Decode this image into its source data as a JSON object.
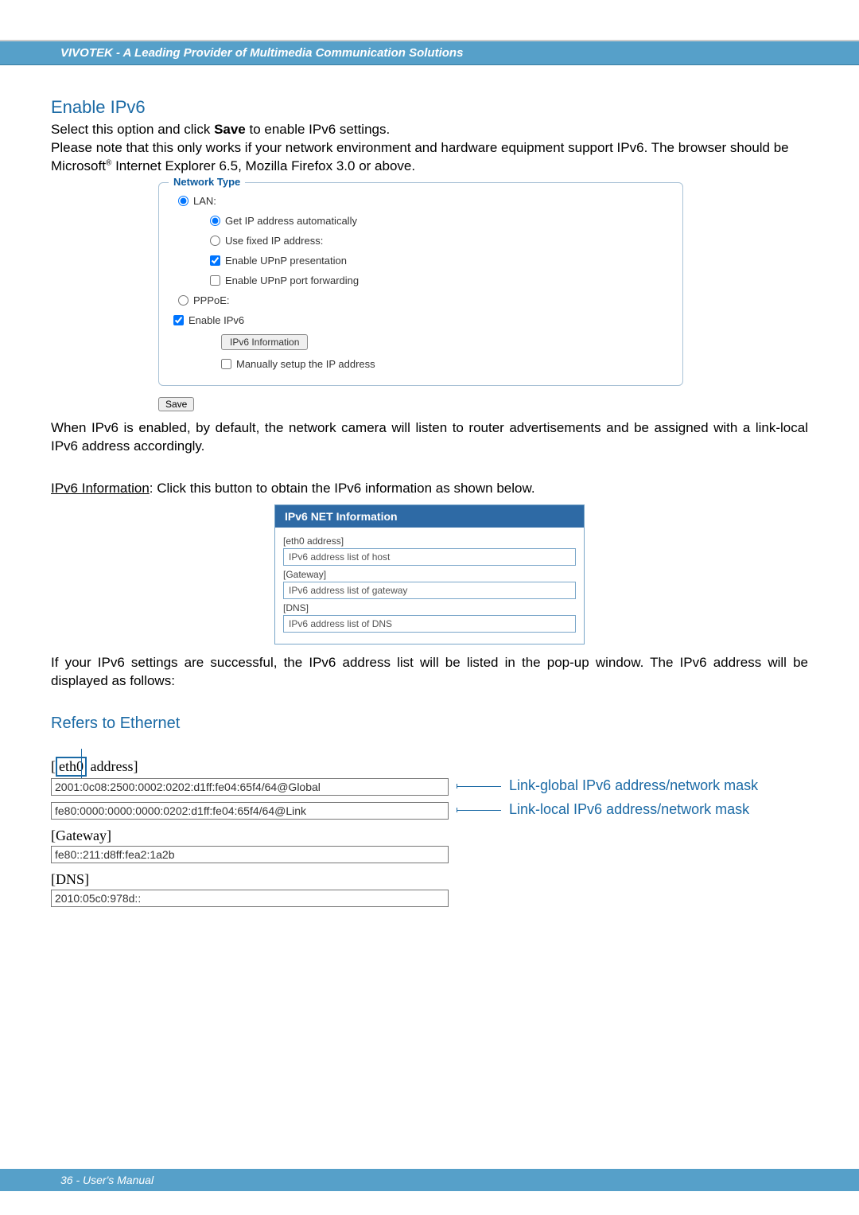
{
  "header": {
    "brand": "VIVOTEK - A Leading Provider of Multimedia Communication Solutions"
  },
  "footer": {
    "text": "36 - User's Manual"
  },
  "section1": {
    "title": "Enable IPv6",
    "p1_a": "Select this option and click ",
    "p1_bold": "Save",
    "p1_b": " to enable IPv6 settings.",
    "p2_a": "Please note that this only works if your network environment and hardware equipment support IPv6. The browser should be Microsoft",
    "p2_sup": "®",
    "p2_b": " Internet Explorer 6.5, Mozilla Firefox 3.0 or above."
  },
  "network_type": {
    "legend": "Network Type",
    "lan": "LAN:",
    "get_ip": "Get IP address automatically",
    "fixed_ip": "Use fixed IP address:",
    "upnp_pres": "Enable UPnP presentation",
    "upnp_port": "Enable UPnP port forwarding",
    "pppoe": "PPPoE:",
    "enable_ipv6": "Enable IPv6",
    "ipv6_info_btn": "IPv6 Information",
    "manual_ip": "Manually setup the IP address",
    "save": "Save"
  },
  "para2": "When IPv6 is enabled, by default, the network camera will listen to router advertisements and be assigned with a link-local IPv6 address accordingly.",
  "ipv6info_line_a": "IPv6 Information",
  "ipv6info_line_b": ": Click this button to obtain the IPv6 information as shown below.",
  "popup": {
    "title": "IPv6 NET Information",
    "eth0_label": "[eth0 address]",
    "eth0_field": "IPv6 address list of host",
    "gw_label": "[Gateway]",
    "gw_field": "IPv6 address list of gateway",
    "dns_label": "[DNS]",
    "dns_field": "IPv6 address list of DNS"
  },
  "para3": "If your IPv6 settings are successful, the IPv6 address list will be listed in the pop-up window. The IPv6 address will be displayed as follows:",
  "eth": {
    "title": "Refers to Ethernet",
    "eth0_boxed": "eth0",
    "addr_word": " address]",
    "bracket_open": "[",
    "global_val": "2001:0c08:2500:0002:0202:d1ff:fe04:65f4/64@Global",
    "link_val": "fe80:0000:0000:0000:0202:d1ff:fe04:65f4/64@Link",
    "global_annot": "Link-global IPv6 address/network mask",
    "link_annot": "Link-local IPv6 address/network mask",
    "gateway_label": "[Gateway]",
    "gateway_val": "fe80::211:d8ff:fea2:1a2b",
    "dns_label": "[DNS]",
    "dns_val": "2010:05c0:978d::"
  }
}
